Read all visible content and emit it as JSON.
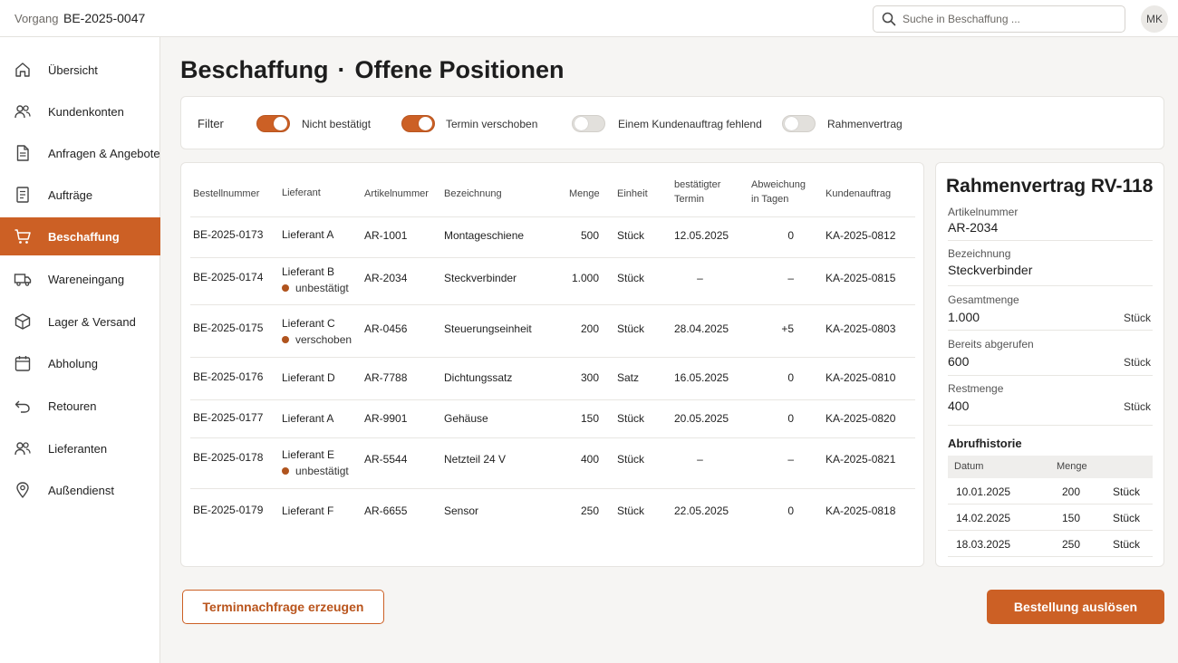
{
  "topbar": {
    "label": "Vorgang",
    "id": "BE-2025-0047",
    "search_placeholder": "Suche in Beschaffung ...",
    "avatar": "MK"
  },
  "sidebar": {
    "items": [
      {
        "label": "Übersicht",
        "icon": "home-icon"
      },
      {
        "label": "Kundenkonten",
        "icon": "users-icon"
      },
      {
        "label": "Anfragen & Angebote",
        "icon": "document-icon"
      },
      {
        "label": "Aufträge",
        "icon": "list-document-icon"
      },
      {
        "label": "Beschaffung",
        "icon": "cart-icon",
        "active": true
      },
      {
        "label": "Wareneingang",
        "icon": "truck-icon"
      },
      {
        "label": "Lager & Versand",
        "icon": "box-icon"
      },
      {
        "label": "Abholung",
        "icon": "calendar-icon"
      },
      {
        "label": "Retouren",
        "icon": "return-icon"
      },
      {
        "label": "Lieferanten",
        "icon": "suppliers-icon"
      },
      {
        "label": "Außendienst",
        "icon": "location-pin-icon"
      }
    ]
  },
  "page": {
    "title_part1": "Beschaffung",
    "separator": "·",
    "title_part2": "Offene Positionen"
  },
  "filters": {
    "label": "Filter",
    "items": [
      {
        "label": "Nicht bestätigt",
        "on": true
      },
      {
        "label": "Termin verschoben",
        "on": true
      },
      {
        "label": "Einem Kundenauftrag fehlend",
        "on": false
      },
      {
        "label": "Rahmenvertrag",
        "on": false
      }
    ]
  },
  "table": {
    "headers": {
      "bestellnummer": "Bestellnummer",
      "lieferant": "Lieferant",
      "artikelnummer": "Artikelnummer",
      "bezeichnung": "Bezeichnung",
      "menge": "Menge",
      "einheit": "Einheit",
      "termin_1": "bestätigter",
      "termin_2": "Termin",
      "abweichung_1": "Abweichung",
      "abweichung_2": "in Tagen",
      "kundenauftrag": "Kundenauftrag"
    },
    "rows": [
      {
        "bestellnummer": "BE-2025-0173",
        "lieferant": "Lieferant A",
        "status": "",
        "artikelnummer": "AR-1001",
        "bezeichnung": "Montageschiene",
        "menge": "500",
        "einheit": "Stück",
        "termin": "12.05.2025",
        "abweichung": "0",
        "kundenauftrag": "KA-2025-0812"
      },
      {
        "bestellnummer": "BE-2025-0174",
        "lieferant": "Lieferant B",
        "status": "unbestätigt",
        "artikelnummer": "AR-2034",
        "bezeichnung": "Steckverbinder",
        "menge": "1.000",
        "einheit": "Stück",
        "termin": "–",
        "abweichung": "–",
        "kundenauftrag": "KA-2025-0815"
      },
      {
        "bestellnummer": "BE-2025-0175",
        "lieferant": "Lieferant C",
        "status": "verschoben",
        "artikelnummer": "AR-0456",
        "bezeichnung": "Steuerungseinheit",
        "menge": "200",
        "einheit": "Stück",
        "termin": "28.04.2025",
        "abweichung": "+5",
        "kundenauftrag": "KA-2025-0803"
      },
      {
        "bestellnummer": "BE-2025-0176",
        "lieferant": "Lieferant D",
        "status": "",
        "artikelnummer": "AR-7788",
        "bezeichnung": "Dichtungssatz",
        "menge": "300",
        "einheit": "Satz",
        "termin": "16.05.2025",
        "abweichung": "0",
        "kundenauftrag": "KA-2025-0810"
      },
      {
        "bestellnummer": "BE-2025-0177",
        "lieferant": "Lieferant A",
        "status": "",
        "artikelnummer": "AR-9901",
        "bezeichnung": "Gehäuse",
        "menge": "150",
        "einheit": "Stück",
        "termin": "20.05.2025",
        "abweichung": "0",
        "kundenauftrag": "KA-2025-0820"
      },
      {
        "bestellnummer": "BE-2025-0178",
        "lieferant": "Lieferant E",
        "status": "unbestätigt",
        "artikelnummer": "AR-5544",
        "bezeichnung": "Netzteil 24 V",
        "menge": "400",
        "einheit": "Stück",
        "termin": "–",
        "abweichung": "–",
        "kundenauftrag": "KA-2025-0821"
      },
      {
        "bestellnummer": "BE-2025-0179",
        "lieferant": "Lieferant F",
        "status": "",
        "artikelnummer": "AR-6655",
        "bezeichnung": "Sensor",
        "menge": "250",
        "einheit": "Stück",
        "termin": "22.05.2025",
        "abweichung": "0",
        "kundenauftrag": "KA-2025-0818"
      }
    ]
  },
  "detail": {
    "title": "Rahmenvertrag RV-118",
    "artikelnummer_label": "Artikelnummer",
    "artikelnummer": "AR-2034",
    "bezeichnung_label": "Bezeichnung",
    "bezeichnung": "Steckverbinder",
    "gesamt_label": "Gesamtmenge",
    "gesamt": "1.000",
    "gesamt_unit": "Stück",
    "abgerufen_label": "Bereits abgerufen",
    "abgerufen": "600",
    "abgerufen_unit": "Stück",
    "rest_label": "Restmenge",
    "rest": "400",
    "rest_unit": "Stück",
    "history_title": "Abrufhistorie",
    "history_headers": {
      "datum": "Datum",
      "menge": "Menge"
    },
    "history": [
      {
        "datum": "10.01.2025",
        "menge": "200",
        "einheit": "Stück"
      },
      {
        "datum": "14.02.2025",
        "menge": "150",
        "einheit": "Stück"
      },
      {
        "datum": "18.03.2025",
        "menge": "250",
        "einheit": "Stück"
      }
    ]
  },
  "actions": {
    "secondary": "Terminnachfrage erzeugen",
    "primary": "Bestellung auslösen"
  },
  "colors": {
    "accent": "#cc6025",
    "status_dot": "#b0541e",
    "background": "#f6f5f3"
  }
}
